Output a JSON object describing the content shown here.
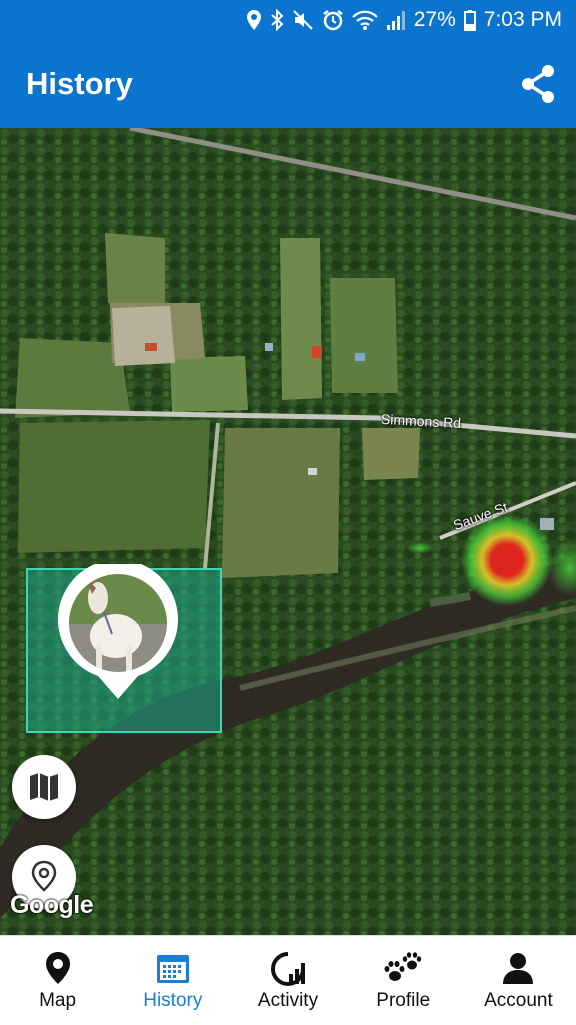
{
  "status_bar": {
    "battery": "27%",
    "time": "7:03 PM",
    "icons": [
      "location-icon",
      "bluetooth-icon",
      "mute-icon",
      "alarm-icon",
      "wifi-icon",
      "signal-icon",
      "battery-icon"
    ]
  },
  "header": {
    "title": "History",
    "share_icon": "share-icon"
  },
  "map": {
    "road_labels": [
      "Simmons Rd",
      "Sauve St"
    ],
    "attribution": "Google",
    "pet_marker_icon": "dog-photo-pin",
    "layers_button_icon": "map-icon",
    "location_button_icon": "location-pin-icon",
    "heat_colors": [
      "#e8231e",
      "#f2d52a",
      "#49d93b"
    ]
  },
  "bottom_nav": {
    "active_color": "#1a7fd4",
    "items": [
      {
        "label": "Map",
        "icon": "map-pin-icon"
      },
      {
        "label": "History",
        "icon": "calendar-icon"
      },
      {
        "label": "Activity",
        "icon": "activity-gauge-icon"
      },
      {
        "label": "Profile",
        "icon": "paw-icon"
      },
      {
        "label": "Account",
        "icon": "person-icon"
      }
    ]
  }
}
